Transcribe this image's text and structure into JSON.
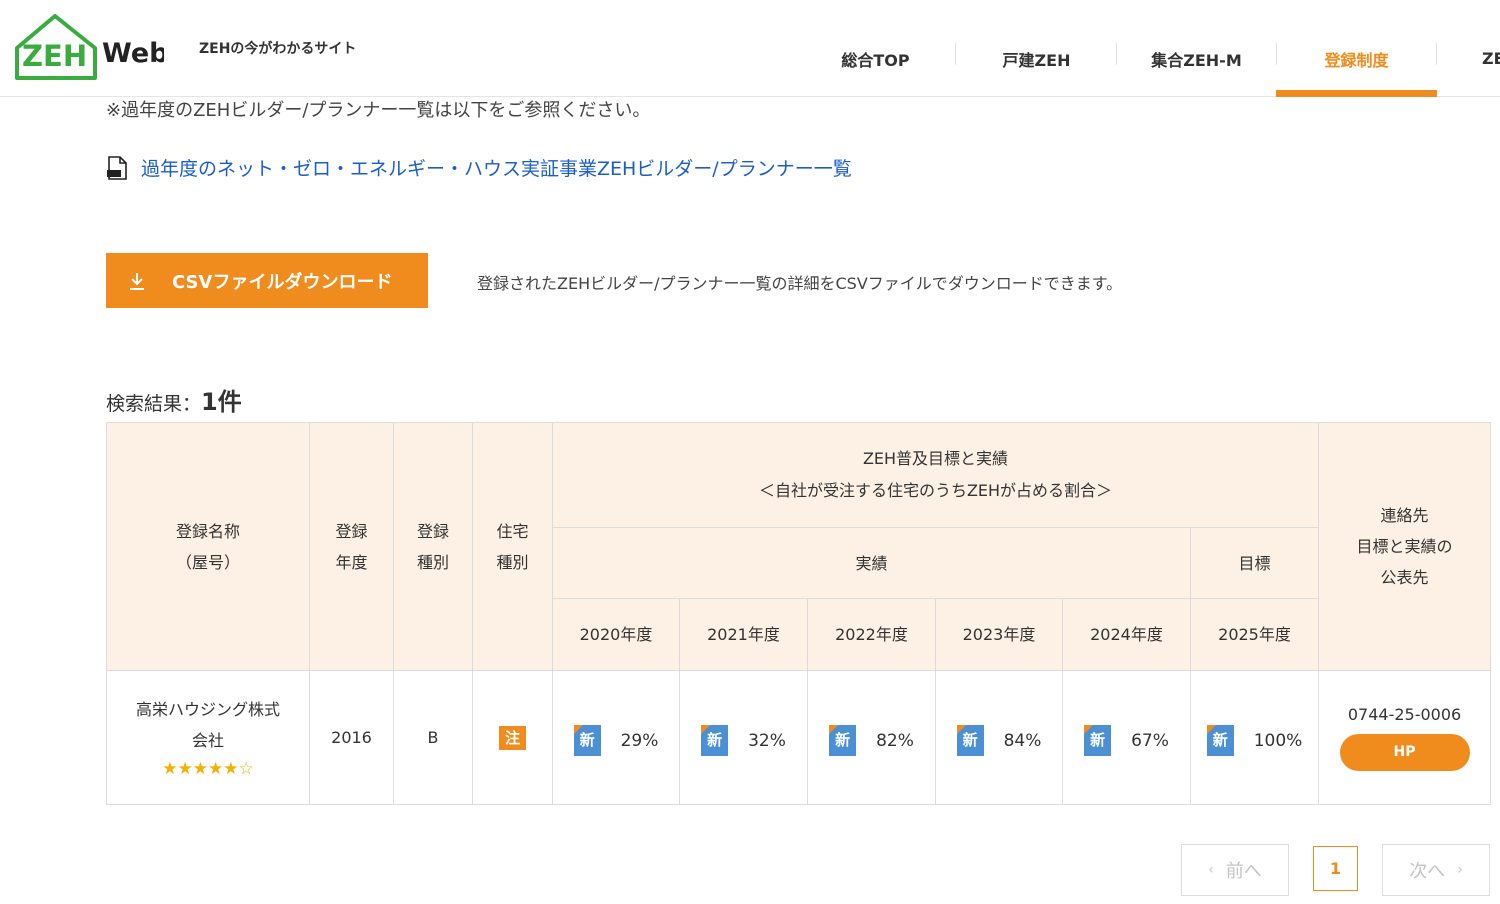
{
  "header": {
    "logo_text": "Web",
    "logo_mark": "ZEH",
    "tagline": "ZEHの今がわかるサイト",
    "nav": [
      {
        "label": "総合TOP",
        "active": false
      },
      {
        "label": "戸建ZEH",
        "active": false
      },
      {
        "label": "集合ZEH-M",
        "active": false
      },
      {
        "label": "登録制度",
        "active": true
      },
      {
        "label": "ZEB",
        "active": false
      }
    ]
  },
  "notes": {
    "past_note": "※過年度のZEHビルダー/プランナー一覧は以下をご参照ください。",
    "past_link": "過年度のネット・ゼロ・エネルギー・ハウス実証事業ZEHビルダー/プランナー一覧",
    "past_link_icon": "pdf-file-icon"
  },
  "csv": {
    "button_label": "CSVファイルダウンロード",
    "button_icon": "download-icon",
    "description": "登録されたZEHビルダー/プランナー一覧の詳細をCSVファイルでダウンロードできます。"
  },
  "results": {
    "label": "検索結果：",
    "count": "1件"
  },
  "table": {
    "headers": {
      "name_line1": "登録名称",
      "name_line2": "（屋号）",
      "year_line1": "登録",
      "year_line2": "年度",
      "type_line1": "登録",
      "type_line2": "種別",
      "housing_line1": "住宅",
      "housing_line2": "種別",
      "target_line1": "ZEH普及目標と実績",
      "target_line2": "＜自社が受注する住宅のうちZEHが占める割合＞",
      "actual": "実績",
      "goal": "目標",
      "contact_line1": "連絡先",
      "contact_line2": "目標と実績の",
      "contact_line3": "公表先",
      "years": [
        "2020年度",
        "2021年度",
        "2022年度",
        "2023年度",
        "2024年度",
        "2025年度"
      ]
    },
    "rows": [
      {
        "name_line1": "高栄ハウジング株式",
        "name_line2": "会社",
        "stars": "★★★★★☆",
        "year": "2016",
        "type": "B",
        "housing_badge": "注",
        "values": [
          {
            "badge": "新",
            "pct": "29%"
          },
          {
            "badge": "新",
            "pct": "32%"
          },
          {
            "badge": "新",
            "pct": "82%"
          },
          {
            "badge": "新",
            "pct": "84%"
          },
          {
            "badge": "新",
            "pct": "67%"
          },
          {
            "badge": "新",
            "pct": "100%"
          }
        ],
        "phone": "0744-25-0006",
        "hp_label": "HP"
      }
    ]
  },
  "pagination": {
    "prev": "前へ",
    "current": "1",
    "next": "次へ",
    "prev_icon": "chevron-left-icon",
    "next_icon": "chevron-right-icon"
  },
  "colors": {
    "accent": "#f08c1e",
    "link": "#1b5fc6",
    "header_bg": "#fdf1e5",
    "badge_blue": "#4c8fd2",
    "star": "#f5b000",
    "logo_green": "#3aab3e"
  }
}
